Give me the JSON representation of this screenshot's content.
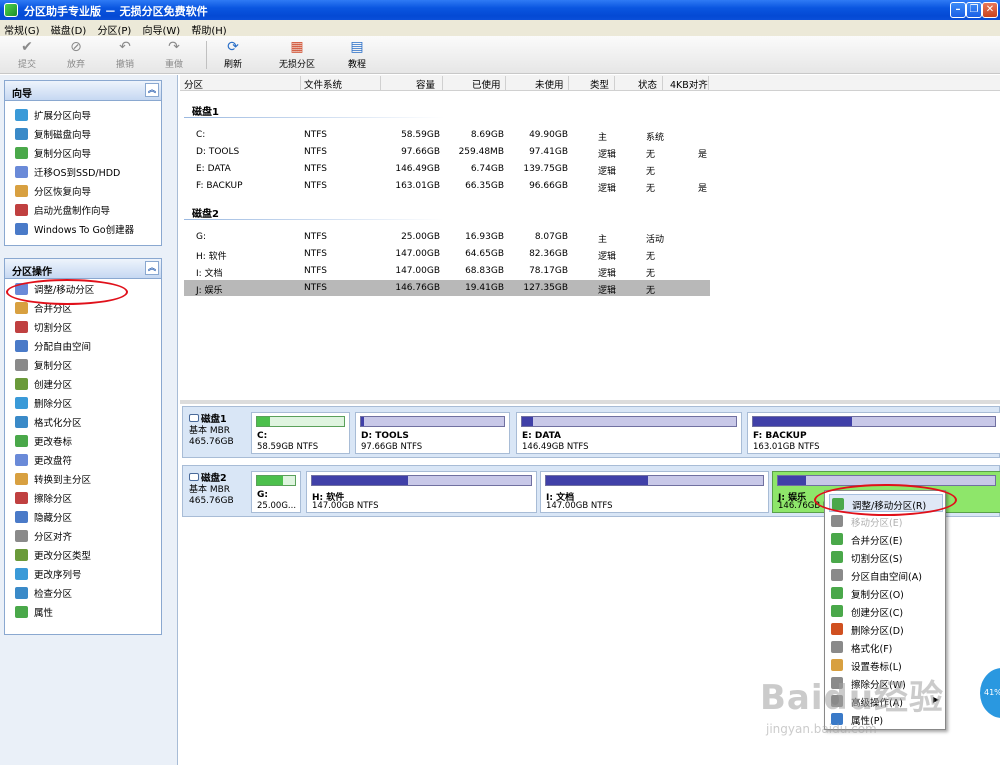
{
  "window": {
    "title": "分区助手专业版 － 无损分区免费软件"
  },
  "menu": [
    "常规(G)",
    "磁盘(D)",
    "分区(P)",
    "向导(W)",
    "帮助(H)"
  ],
  "toolbar": {
    "commit": "提交",
    "discard": "放弃",
    "undo": "撤销",
    "redo": "重做",
    "refresh": "刷新",
    "lossless": "无损分区",
    "tutorial": "教程"
  },
  "wizard_panel": {
    "title": "向导",
    "items": [
      "扩展分区向导",
      "复制磁盘向导",
      "复制分区向导",
      "迁移OS到SSD/HDD",
      "分区恢复向导",
      "启动光盘制作向导",
      "Windows To Go创建器"
    ]
  },
  "ops_panel": {
    "title": "分区操作",
    "items": [
      "调整/移动分区",
      "合并分区",
      "切割分区",
      "分配自由空间",
      "复制分区",
      "创建分区",
      "删除分区",
      "格式化分区",
      "更改卷标",
      "更改盘符",
      "转换到主分区",
      "擦除分区",
      "隐藏分区",
      "分区对齐",
      "更改分区类型",
      "更改序列号",
      "检查分区",
      "属性"
    ]
  },
  "table": {
    "headers": [
      "分区",
      "文件系统",
      "容量",
      "已使用",
      "未使用",
      "类型",
      "状态",
      "4KB对齐"
    ],
    "disks": [
      {
        "name": "磁盘1",
        "rows": [
          [
            "C:",
            "NTFS",
            "58.59GB",
            "8.69GB",
            "49.90GB",
            "主",
            "系统",
            ""
          ],
          [
            "D: TOOLS",
            "NTFS",
            "97.66GB",
            "259.48MB",
            "97.41GB",
            "逻辑",
            "无",
            "是"
          ],
          [
            "E: DATA",
            "NTFS",
            "146.49GB",
            "6.74GB",
            "139.75GB",
            "逻辑",
            "无",
            ""
          ],
          [
            "F: BACKUP",
            "NTFS",
            "163.01GB",
            "66.35GB",
            "96.66GB",
            "逻辑",
            "无",
            "是"
          ]
        ]
      },
      {
        "name": "磁盘2",
        "rows": [
          [
            "G:",
            "NTFS",
            "25.00GB",
            "16.93GB",
            "8.07GB",
            "主",
            "活动",
            ""
          ],
          [
            "H: 软件",
            "NTFS",
            "147.00GB",
            "64.65GB",
            "82.36GB",
            "逻辑",
            "无",
            ""
          ],
          [
            "I: 文档",
            "NTFS",
            "147.00GB",
            "68.83GB",
            "78.17GB",
            "逻辑",
            "无",
            ""
          ],
          [
            "J: 娱乐",
            "NTFS",
            "146.76GB",
            "19.41GB",
            "127.35GB",
            "逻辑",
            "无",
            ""
          ]
        ]
      }
    ]
  },
  "diskmap": [
    {
      "name": "磁盘1",
      "type": "基本 MBR",
      "size": "465.76GB",
      "parts": [
        {
          "name": "C:",
          "size": "58.59GB NTFS",
          "used": 0.15,
          "style": "green"
        },
        {
          "name": "D: TOOLS",
          "size": "97.66GB NTFS",
          "used": 0.01,
          "style": "blue"
        },
        {
          "name": "E: DATA",
          "size": "146.49GB NTFS",
          "used": 0.05,
          "style": "blue"
        },
        {
          "name": "F: BACKUP",
          "size": "163.01GB NTFS",
          "used": 0.41,
          "style": "blue"
        }
      ]
    },
    {
      "name": "磁盘2",
      "type": "基本 MBR",
      "size": "465.76GB",
      "parts": [
        {
          "name": "G:",
          "size": "25.00G...",
          "used": 0.68,
          "style": "green"
        },
        {
          "name": "H: 软件",
          "size": "147.00GB NTFS",
          "used": 0.44,
          "style": "blue"
        },
        {
          "name": "I: 文档",
          "size": "147.00GB NTFS",
          "used": 0.47,
          "style": "blue"
        },
        {
          "name": "J: 娱乐",
          "size": "146.76GB NTFS",
          "used": 0.13,
          "style": "blue"
        }
      ]
    }
  ],
  "context_menu": {
    "items": [
      "调整/移动分区(R)",
      "移动分区(E)",
      "合并分区(E)",
      "切割分区(S)",
      "分区自由空间(A)",
      "复制分区(O)",
      "创建分区(C)",
      "删除分区(D)",
      "格式化(F)",
      "设置卷标(L)",
      "擦除分区(W)",
      "高级操作(A)",
      "属性(P)"
    ]
  },
  "watermark": {
    "logo": "Baidu经验",
    "url": "jingyan.baidu.com"
  },
  "badge": "41%",
  "colors": {
    "titlebar": "#0a56e0",
    "highlight_ellipse": "#e0101a",
    "selected_partition": "#8ee66a",
    "used_fill": "#4040a8"
  }
}
